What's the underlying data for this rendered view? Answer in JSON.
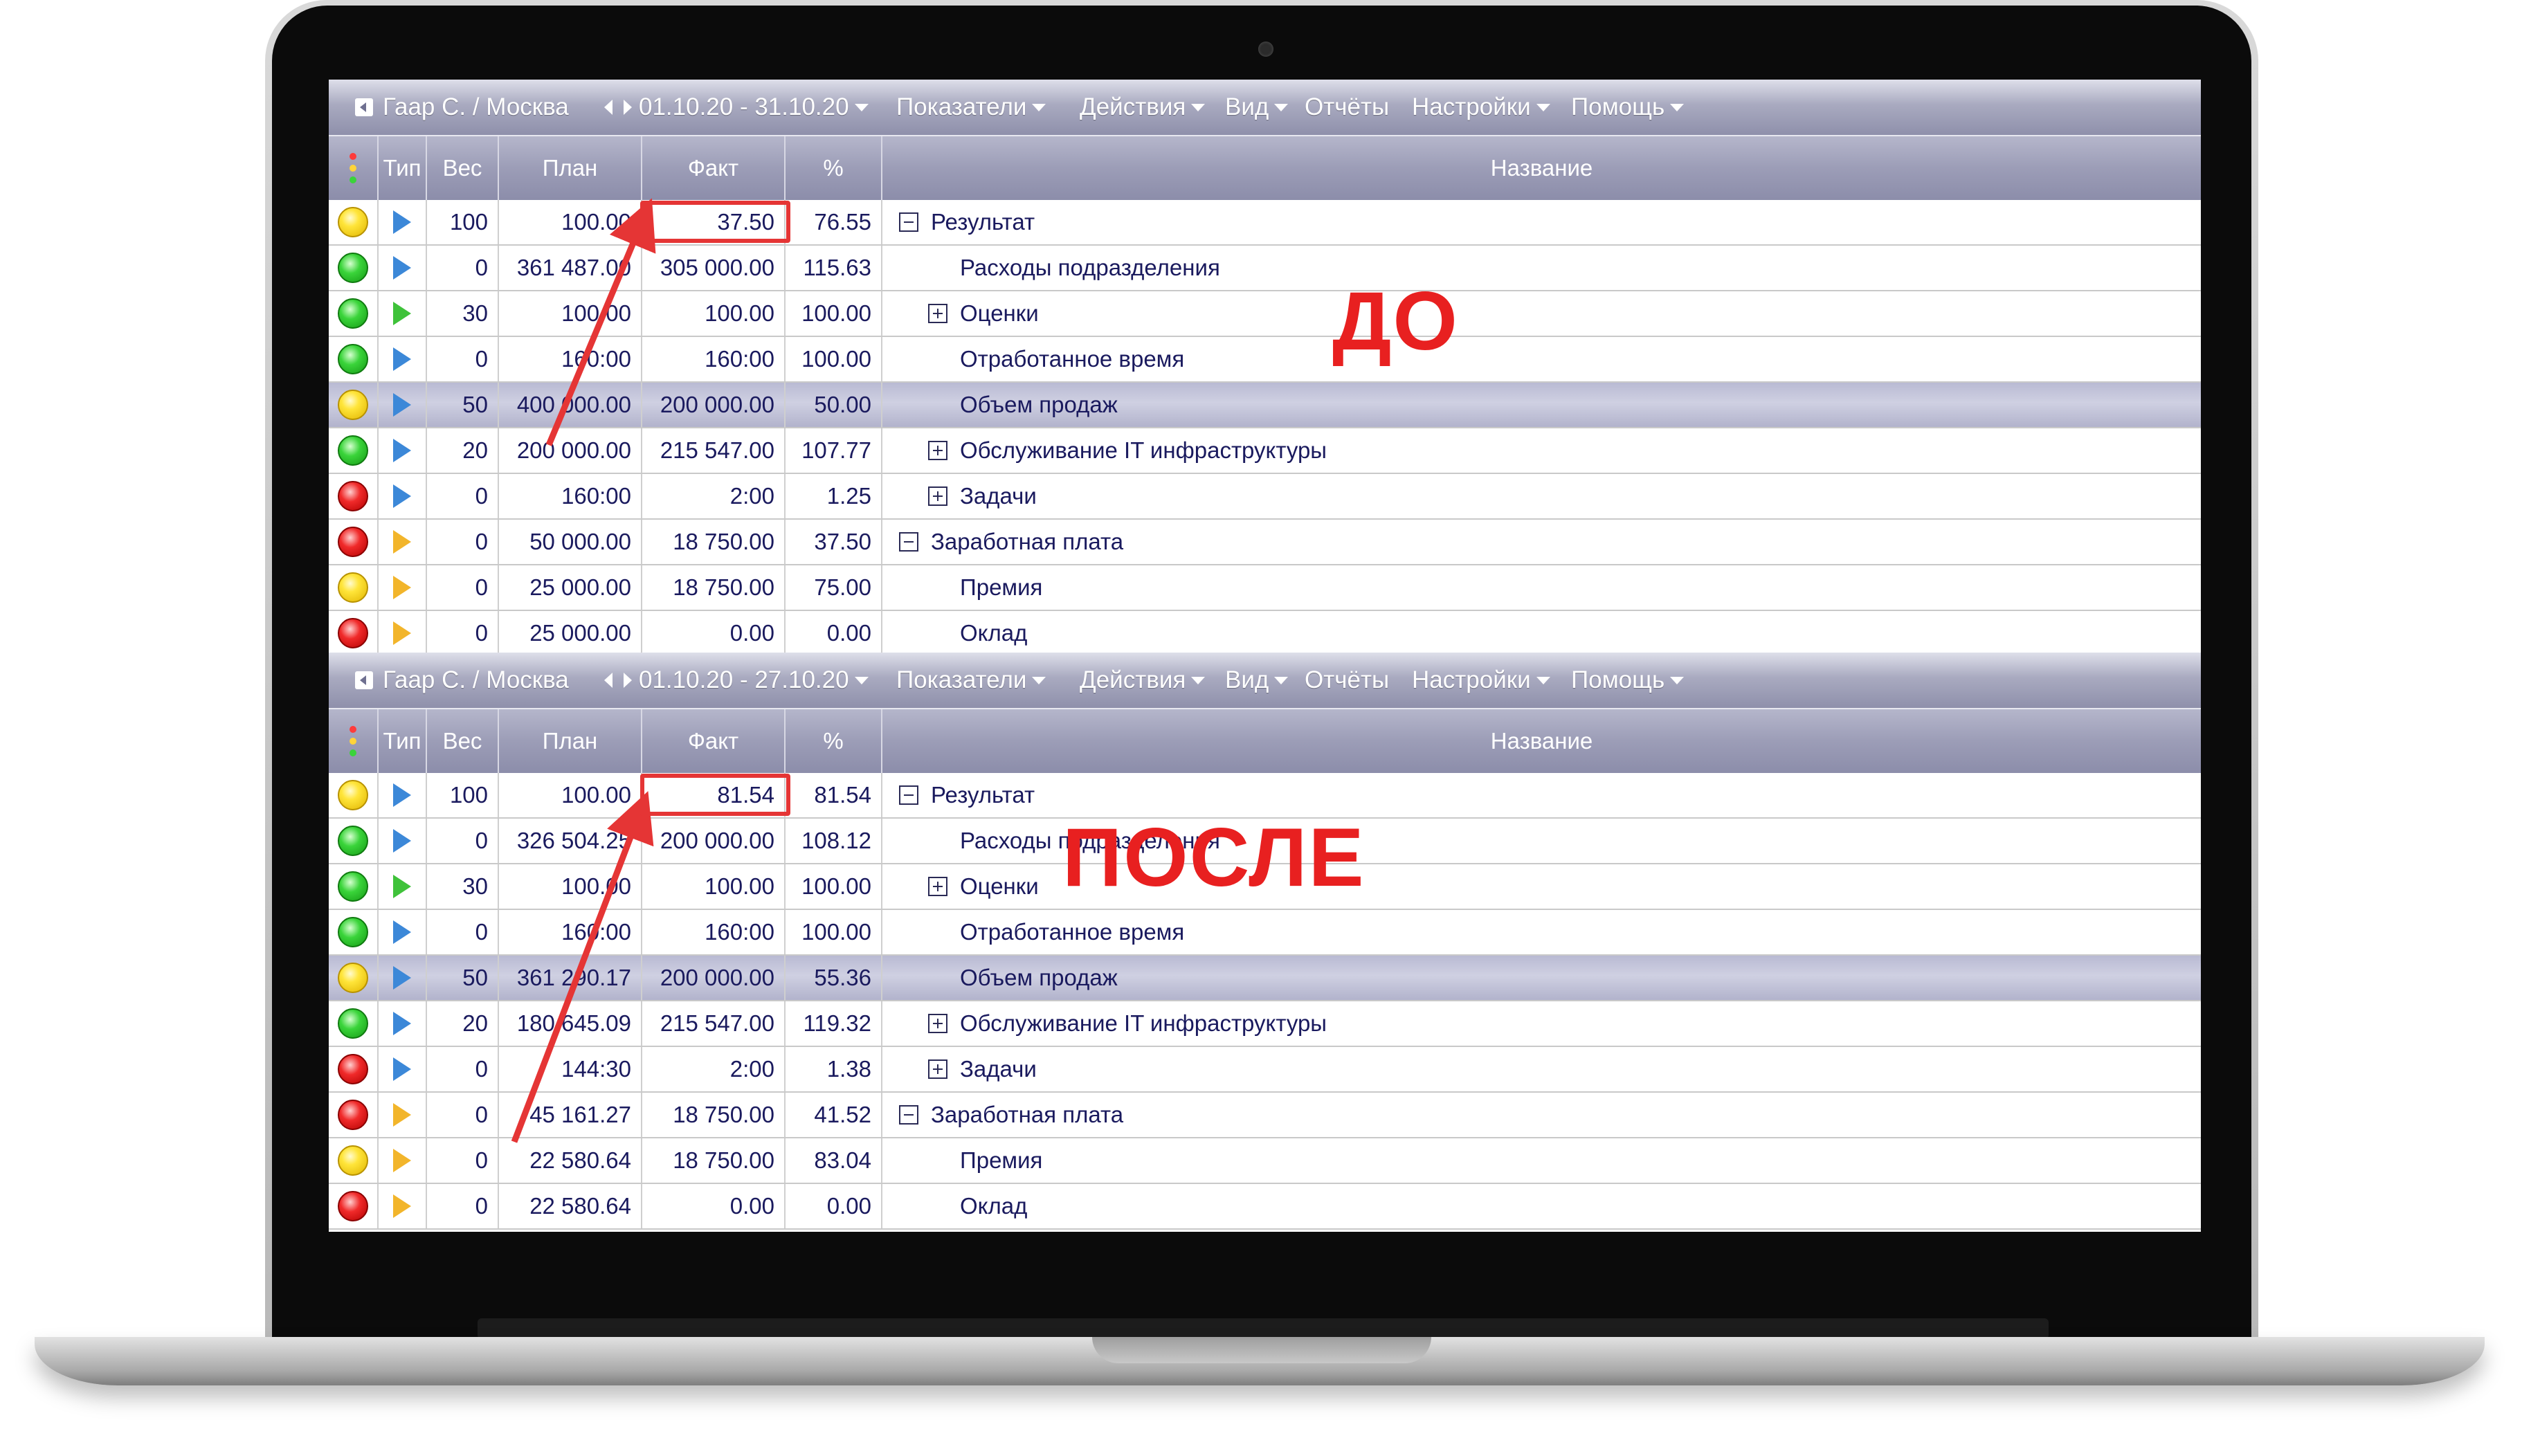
{
  "panels": [
    {
      "toolbar": {
        "user": "Гаар С. / Москва",
        "period": "01.10.20 - 31.10.20",
        "menu": [
          "Показатели",
          "Действия",
          "Вид",
          "Отчёты",
          "Настройки",
          "Помощь"
        ]
      },
      "columns": {
        "type": "Тип",
        "weight": "Вес",
        "plan": "План",
        "fact": "Факт",
        "pct": "%",
        "name": "Название"
      },
      "rows": [
        {
          "status": "yellow",
          "type_icon": "blue",
          "weight": "100",
          "plan": "100.00",
          "fact": "37.50",
          "pct": "76.55",
          "name": "Результат",
          "tree": "minus",
          "indent": 0
        },
        {
          "status": "green",
          "type_icon": "blue",
          "weight": "0",
          "plan": "361 487.00",
          "fact": "305 000.00",
          "pct": "115.63",
          "name": "Расходы подразделения",
          "tree": "none",
          "indent": 1
        },
        {
          "status": "green",
          "type_icon": "green",
          "weight": "30",
          "plan": "100.00",
          "fact": "100.00",
          "pct": "100.00",
          "name": "Оценки",
          "tree": "plus",
          "indent": 1
        },
        {
          "status": "green",
          "type_icon": "blue",
          "weight": "0",
          "plan": "160:00",
          "fact": "160:00",
          "pct": "100.00",
          "name": "Отработанное время",
          "tree": "none",
          "indent": 1
        },
        {
          "status": "yellow",
          "type_icon": "blue",
          "weight": "50",
          "plan": "400 000.00",
          "fact": "200 000.00",
          "pct": "50.00",
          "name": "Объем продаж",
          "tree": "none",
          "indent": 1,
          "highlight": true
        },
        {
          "status": "green",
          "type_icon": "blue",
          "weight": "20",
          "plan": "200 000.00",
          "fact": "215 547.00",
          "pct": "107.77",
          "name": "Обслуживание IT инфраструктуры",
          "tree": "plus",
          "indent": 1
        },
        {
          "status": "red",
          "type_icon": "blue",
          "weight": "0",
          "plan": "160:00",
          "fact": "2:00",
          "pct": "1.25",
          "name": "Задачи",
          "tree": "plus",
          "indent": 1
        },
        {
          "status": "red",
          "type_icon": "orange",
          "weight": "0",
          "plan": "50 000.00",
          "fact": "18 750.00",
          "pct": "37.50",
          "name": "Заработная плата",
          "tree": "minus",
          "indent": 0
        },
        {
          "status": "yellow",
          "type_icon": "orange",
          "weight": "0",
          "plan": "25 000.00",
          "fact": "18 750.00",
          "pct": "75.00",
          "name": "Премия",
          "tree": "none",
          "indent": 1
        },
        {
          "status": "red",
          "type_icon": "orange",
          "weight": "0",
          "plan": "25 000.00",
          "fact": "0.00",
          "pct": "0.00",
          "name": "Оклад",
          "tree": "none",
          "indent": 1
        }
      ]
    },
    {
      "toolbar": {
        "user": "Гаар С. / Москва",
        "period": "01.10.20 - 27.10.20",
        "menu": [
          "Показатели",
          "Действия",
          "Вид",
          "Отчёты",
          "Настройки",
          "Помощь"
        ]
      },
      "columns": {
        "type": "Тип",
        "weight": "Вес",
        "plan": "План",
        "fact": "Факт",
        "pct": "%",
        "name": "Название"
      },
      "rows": [
        {
          "status": "yellow",
          "type_icon": "blue",
          "weight": "100",
          "plan": "100.00",
          "fact": "81.54",
          "pct": "81.54",
          "name": "Результат",
          "tree": "minus",
          "indent": 0
        },
        {
          "status": "green",
          "type_icon": "blue",
          "weight": "0",
          "plan": "326 504.25",
          "fact": "200 000.00",
          "pct": "108.12",
          "name": "Расходы подразделения",
          "tree": "none",
          "indent": 1
        },
        {
          "status": "green",
          "type_icon": "green",
          "weight": "30",
          "plan": "100.00",
          "fact": "100.00",
          "pct": "100.00",
          "name": "Оценки",
          "tree": "plus",
          "indent": 1
        },
        {
          "status": "green",
          "type_icon": "blue",
          "weight": "0",
          "plan": "160:00",
          "fact": "160:00",
          "pct": "100.00",
          "name": "Отработанное время",
          "tree": "none",
          "indent": 1
        },
        {
          "status": "yellow",
          "type_icon": "blue",
          "weight": "50",
          "plan": "361 290.17",
          "fact": "200 000.00",
          "pct": "55.36",
          "name": "Объем продаж",
          "tree": "none",
          "indent": 1,
          "highlight": true
        },
        {
          "status": "green",
          "type_icon": "blue",
          "weight": "20",
          "plan": "180 645.09",
          "fact": "215 547.00",
          "pct": "119.32",
          "name": "Обслуживание IT инфраструктуры",
          "tree": "plus",
          "indent": 1
        },
        {
          "status": "red",
          "type_icon": "blue",
          "weight": "0",
          "plan": "144:30",
          "fact": "2:00",
          "pct": "1.38",
          "name": "Задачи",
          "tree": "plus",
          "indent": 1
        },
        {
          "status": "red",
          "type_icon": "orange",
          "weight": "0",
          "plan": "45 161.27",
          "fact": "18 750.00",
          "pct": "41.52",
          "name": "Заработная плата",
          "tree": "minus",
          "indent": 0
        },
        {
          "status": "yellow",
          "type_icon": "orange",
          "weight": "0",
          "plan": "22 580.64",
          "fact": "18 750.00",
          "pct": "83.04",
          "name": "Премия",
          "tree": "none",
          "indent": 1
        },
        {
          "status": "red",
          "type_icon": "orange",
          "weight": "0",
          "plan": "22 580.64",
          "fact": "0.00",
          "pct": "0.00",
          "name": "Оклад",
          "tree": "none",
          "indent": 1
        }
      ]
    }
  ],
  "annotations": {
    "before_label": "ДО",
    "after_label": "ПОСЛЕ",
    "accent_color": "#e53535"
  },
  "colors": {
    "toolbar": "#9c9db7",
    "text": "#1a1a5e",
    "status_green": "#3ad43a",
    "status_yellow": "#ffe53a",
    "status_red": "#f02a2a"
  }
}
